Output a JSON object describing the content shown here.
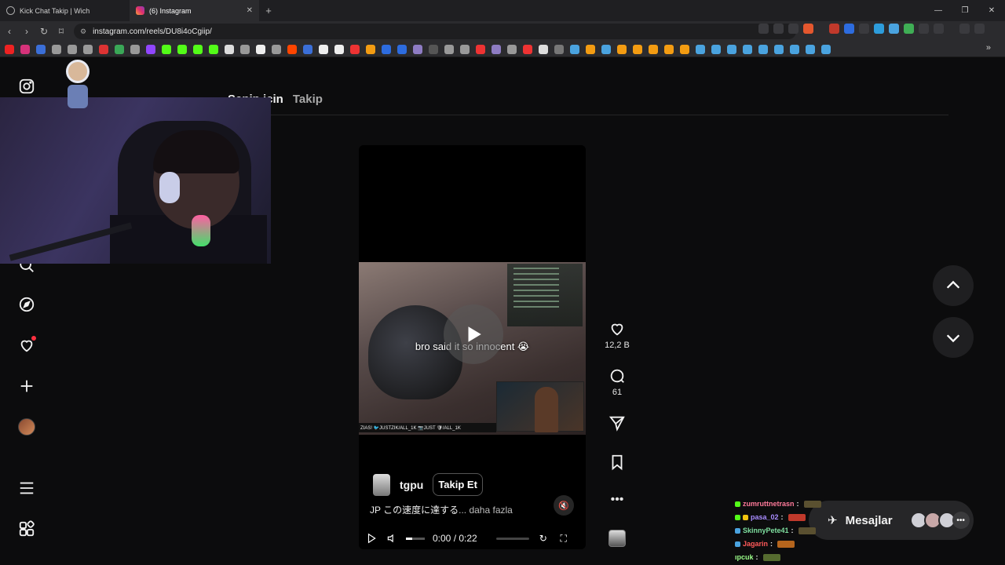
{
  "browser": {
    "tabs": [
      {
        "title": "Kick Chat Takip | Wich",
        "active": false
      },
      {
        "title": "(6) Instagram",
        "active": true
      }
    ],
    "url": "instagram.com/reels/DU8i4oCgiip/",
    "window_controls": [
      "—",
      "❐",
      "✕"
    ]
  },
  "page": {
    "nav_tabs": [
      "Senin için",
      "Takip"
    ],
    "sidebar_icons": [
      "instagram-logo-icon",
      "search-icon",
      "explore-icon",
      "notifications-heart-icon",
      "create-plus-icon",
      "profile-avatar",
      "more-menu-icon",
      "meta-apps-icon"
    ],
    "accent_color": "#ff3040"
  },
  "reel": {
    "video_caption": "bro said it so innocent 😭",
    "overlay_banner": "ZIAS! 🐦JUSTZIK/ALL_1K 📷JUST 🛡/ALL_1K",
    "uploader": "tgpu",
    "follow_label": "Takip Et",
    "description": "JP この速度に達する",
    "description_ellipsis": "... daha fazla",
    "time_display": "0:00 / 0:22",
    "likes": "12,2 B",
    "comments": "61"
  },
  "messages": {
    "label": "Mesajlar"
  },
  "chat_overlay": [
    {
      "user": "zumruttnetrasn",
      "color": "#ff7a9a"
    },
    {
      "user": "pasa_02",
      "color": "#a98cff"
    },
    {
      "user": "SkinnyPete41",
      "color": "#7fe0a0"
    },
    {
      "user": "Jagarin",
      "color": "#ff5a5a"
    },
    {
      "user": "ıpcuk",
      "color": "#9cff8a"
    }
  ]
}
